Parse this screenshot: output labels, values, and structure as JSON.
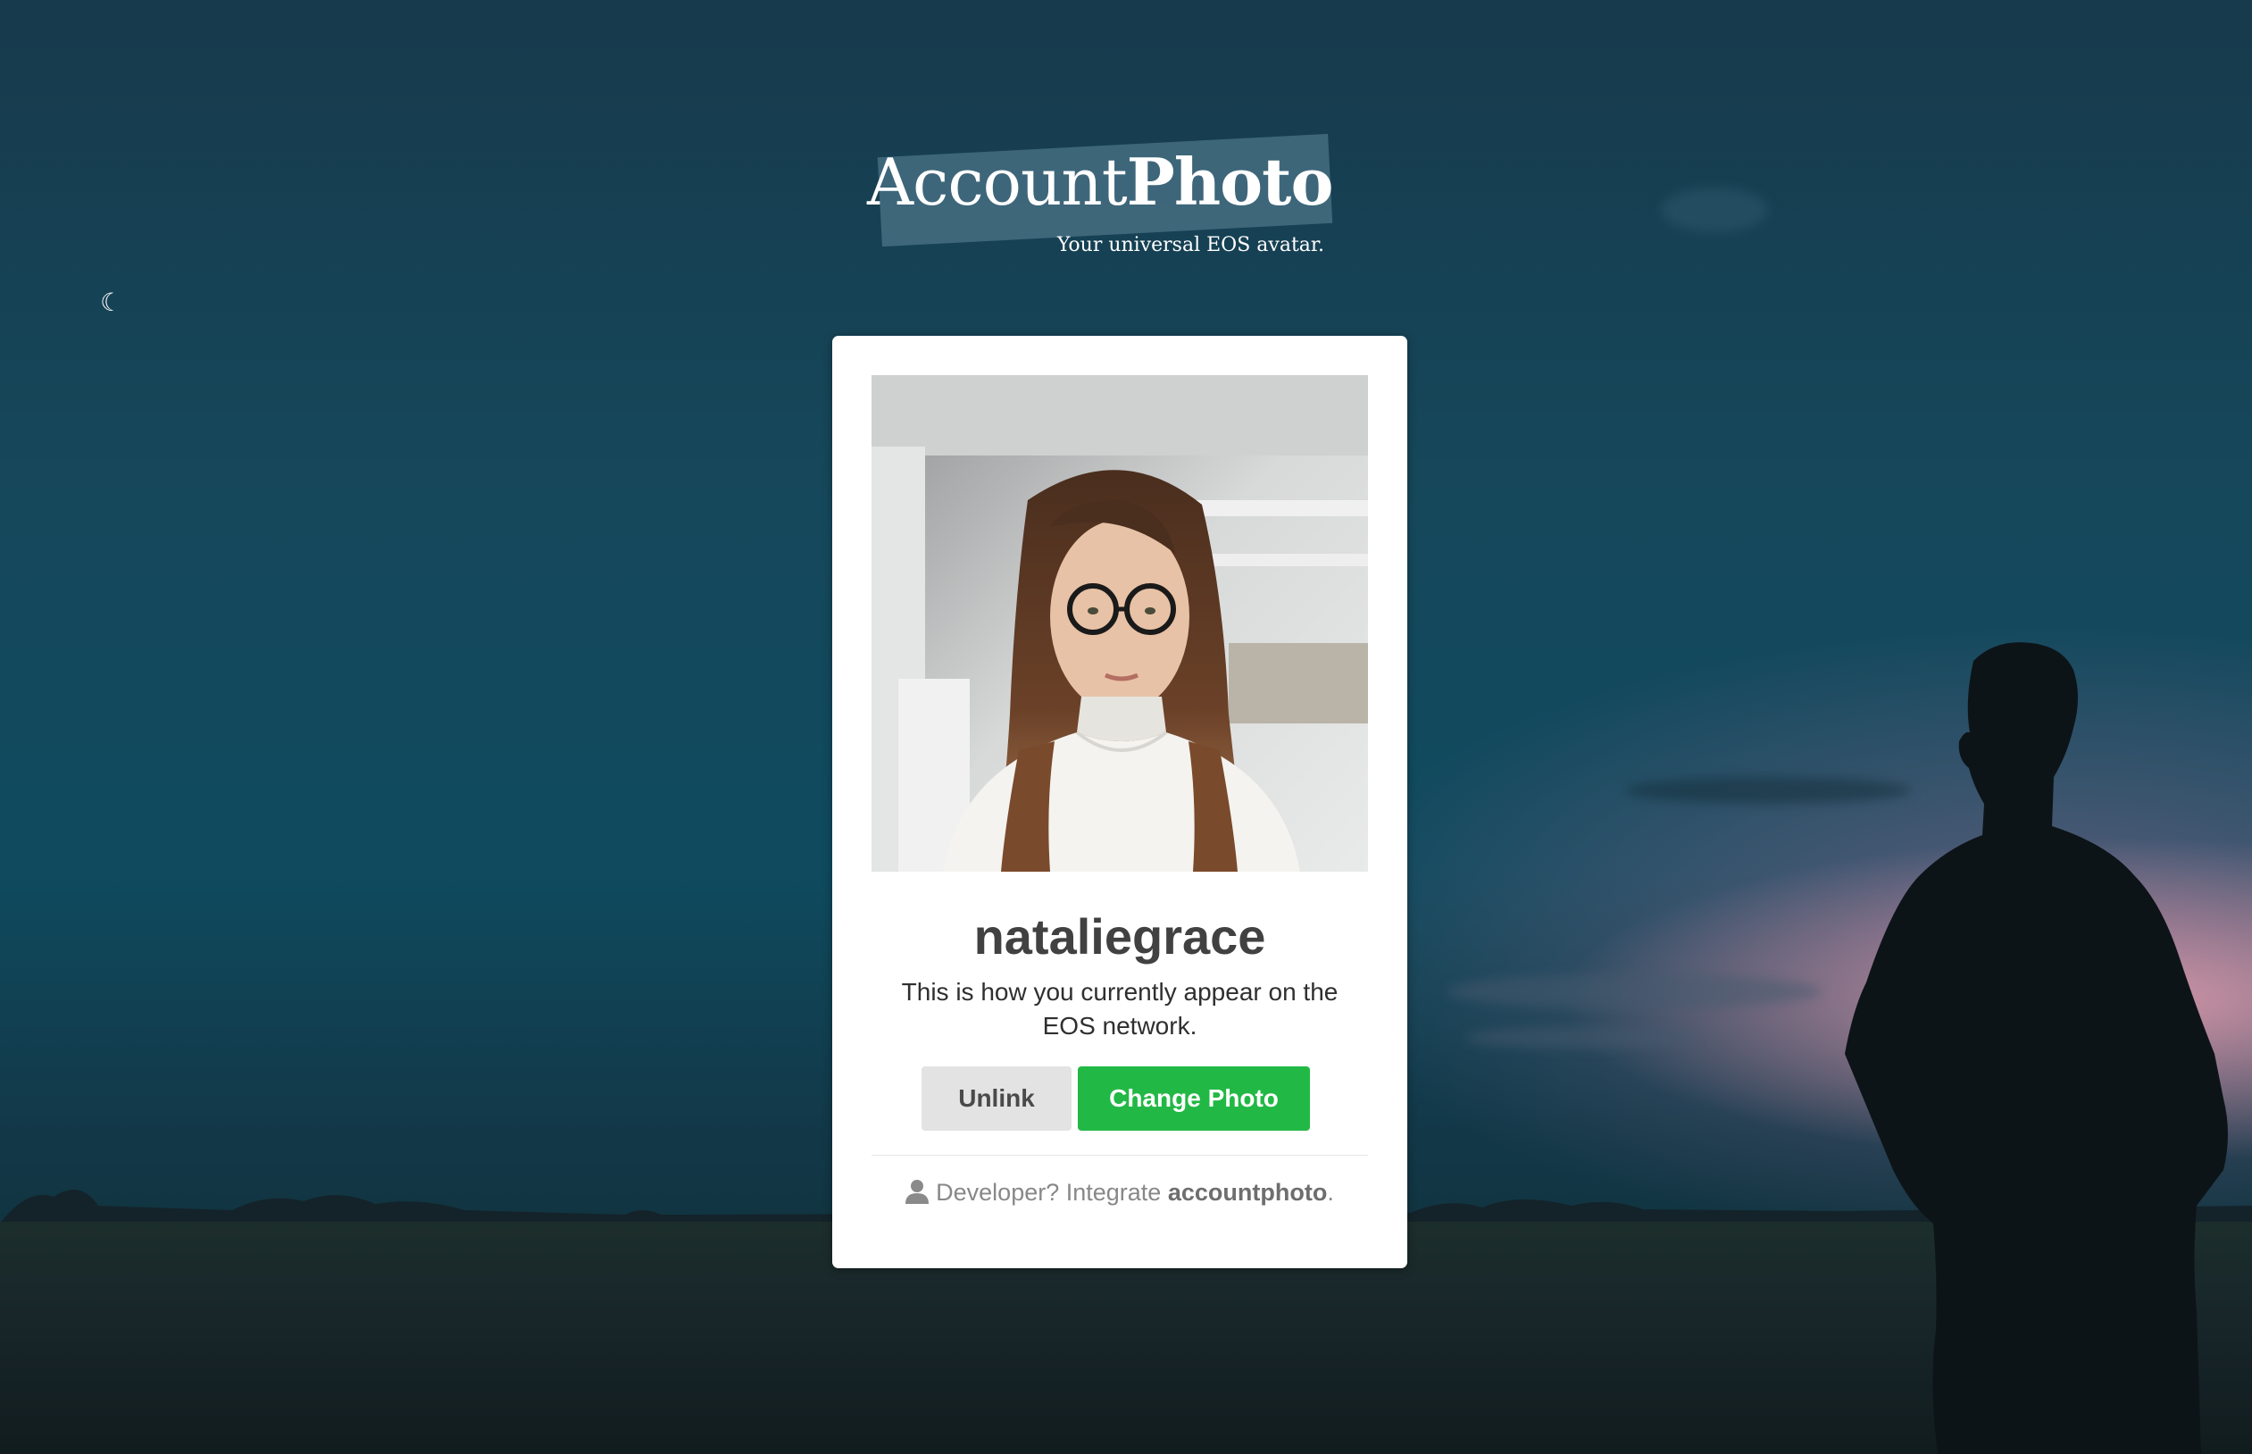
{
  "logo": {
    "title_light": "Account",
    "title_bold": "Photo",
    "tagline": "Your universal EOS avatar."
  },
  "profile": {
    "username": "nataliegrace",
    "description": "This is how you currently appear on the EOS network.",
    "avatar_icon": "profile-photo"
  },
  "actions": {
    "unlink_label": "Unlink",
    "change_photo_label": "Change Photo"
  },
  "footer": {
    "prefix": "Developer? Integrate ",
    "link": "accountphoto",
    "suffix": ".",
    "icon": "user-icon"
  },
  "colors": {
    "primary_button": "#22b845",
    "secondary_button": "#e3e3e3"
  }
}
